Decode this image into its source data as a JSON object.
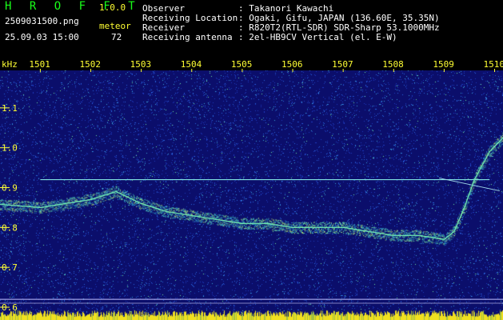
{
  "app": {
    "title": "H R O F F T",
    "version": "1.0.0"
  },
  "file": {
    "name": "2509031500.png",
    "datetime": "25.09.03 15:00"
  },
  "meteor": {
    "label": "meteor",
    "count": "72"
  },
  "info": [
    {
      "label": "Observer",
      "value": ": Takanori Kawachi"
    },
    {
      "label": "Receiving Location",
      "value": ": Ogaki, Gifu, JAPAN (136.60E, 35.35N)"
    },
    {
      "label": "Receiver",
      "value": ": R820T2(RTL-SDR) SDR-Sharp 53.1000MHz"
    },
    {
      "label": "Receiving antenna",
      "value": ": 2el-HB9CV Vertical (el. E-W)"
    }
  ],
  "colors": {
    "green": "#19ff19",
    "yellow": "#ffff33",
    "background": "#0b0e6b"
  },
  "chart_data": {
    "type": "heatmap",
    "ylabel": "kHz",
    "yticks": [
      "1.1",
      "1.0",
      "0.9",
      "0.8",
      "0.7",
      "0.6"
    ],
    "xticks": [
      "1501",
      "1502",
      "1503",
      "1504",
      "1505",
      "1506",
      "1507",
      "1508",
      "1509",
      "1510"
    ],
    "ylim": [
      0.58,
      1.19
    ],
    "carrier_khz": 0.92,
    "drift_trace": [
      {
        "x": 1500.0,
        "y": 0.86
      },
      {
        "x": 1501.0,
        "y": 0.85
      },
      {
        "x": 1502.0,
        "y": 0.87
      },
      {
        "x": 1502.5,
        "y": 0.89
      },
      {
        "x": 1503.0,
        "y": 0.86
      },
      {
        "x": 1503.5,
        "y": 0.84
      },
      {
        "x": 1504.0,
        "y": 0.83
      },
      {
        "x": 1504.5,
        "y": 0.82
      },
      {
        "x": 1505.0,
        "y": 0.81
      },
      {
        "x": 1505.5,
        "y": 0.81
      },
      {
        "x": 1506.0,
        "y": 0.8
      },
      {
        "x": 1507.0,
        "y": 0.8
      },
      {
        "x": 1507.5,
        "y": 0.79
      },
      {
        "x": 1508.0,
        "y": 0.78
      },
      {
        "x": 1508.5,
        "y": 0.78
      },
      {
        "x": 1509.0,
        "y": 0.77
      },
      {
        "x": 1509.2,
        "y": 0.79
      },
      {
        "x": 1509.4,
        "y": 0.85
      },
      {
        "x": 1509.6,
        "y": 0.92
      },
      {
        "x": 1509.9,
        "y": 0.99
      },
      {
        "x": 1510.2,
        "y": 1.03
      }
    ]
  }
}
